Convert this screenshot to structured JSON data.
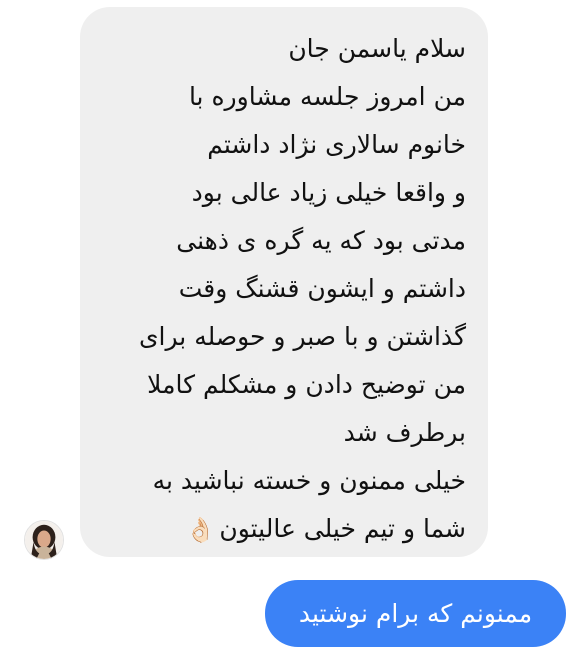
{
  "conversation": {
    "incoming_message": {
      "lines": [
        "سلام یاسمن جان",
        "من امروز جلسه مشاوره با",
        "خانوم سالاری نژاد داشتم",
        "و واقعا خیلی زیاد عالی بود",
        "مدتی بود که یه گره ی ذهنی",
        "داشتم و ایشون قشنگ وقت",
        "گذاشتن و با صبر و حوصله برای",
        "من توضیح دادن و مشکلم کاملا",
        "برطرف شد",
        "خیلی ممنون و خسته نباشید به",
        "شما و تیم خیلی عالیتون"
      ],
      "emoji": "👌🏻",
      "emoji_icon": "ok-hand-icon",
      "bubble_color": "#efefef",
      "text_color": "#111111"
    },
    "outgoing_message": {
      "text": "ممنونم که برام نوشتید",
      "bubble_color": "#3b82f6",
      "text_color": "#ffffff"
    },
    "sender": {
      "avatar_icon": "profile-photo-icon"
    }
  }
}
